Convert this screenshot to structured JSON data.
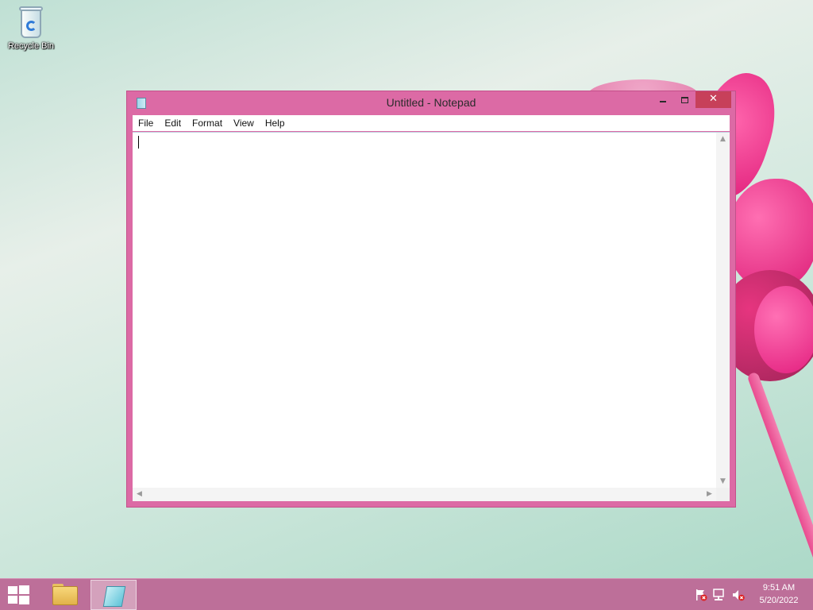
{
  "desktop": {
    "icons": [
      {
        "label": "Recycle Bin",
        "icon": "recycle-bin-icon"
      }
    ]
  },
  "window": {
    "title": "Untitled - Notepad",
    "app_icon": "notepad-icon",
    "controls": {
      "minimize": "minimize-icon",
      "maximize": "maximize-icon",
      "close": "✕"
    },
    "menu": [
      "File",
      "Edit",
      "Format",
      "View",
      "Help"
    ],
    "editor": {
      "content": ""
    }
  },
  "taskbar": {
    "start_icon": "windows-logo-icon",
    "pinned": [
      {
        "name": "File Explorer",
        "icon": "folder-icon"
      },
      {
        "name": "Notepad",
        "icon": "notepad-icon",
        "active": true
      }
    ],
    "tray": {
      "icons": [
        "action-center-flag-icon",
        "network-icon",
        "volume-muted-icon"
      ],
      "time": "9:51 AM",
      "date": "5/20/2022"
    }
  },
  "colors": {
    "window_frame": "#dc6aa5",
    "close_button": "#c7405a",
    "taskbar": "#bd6f99"
  }
}
